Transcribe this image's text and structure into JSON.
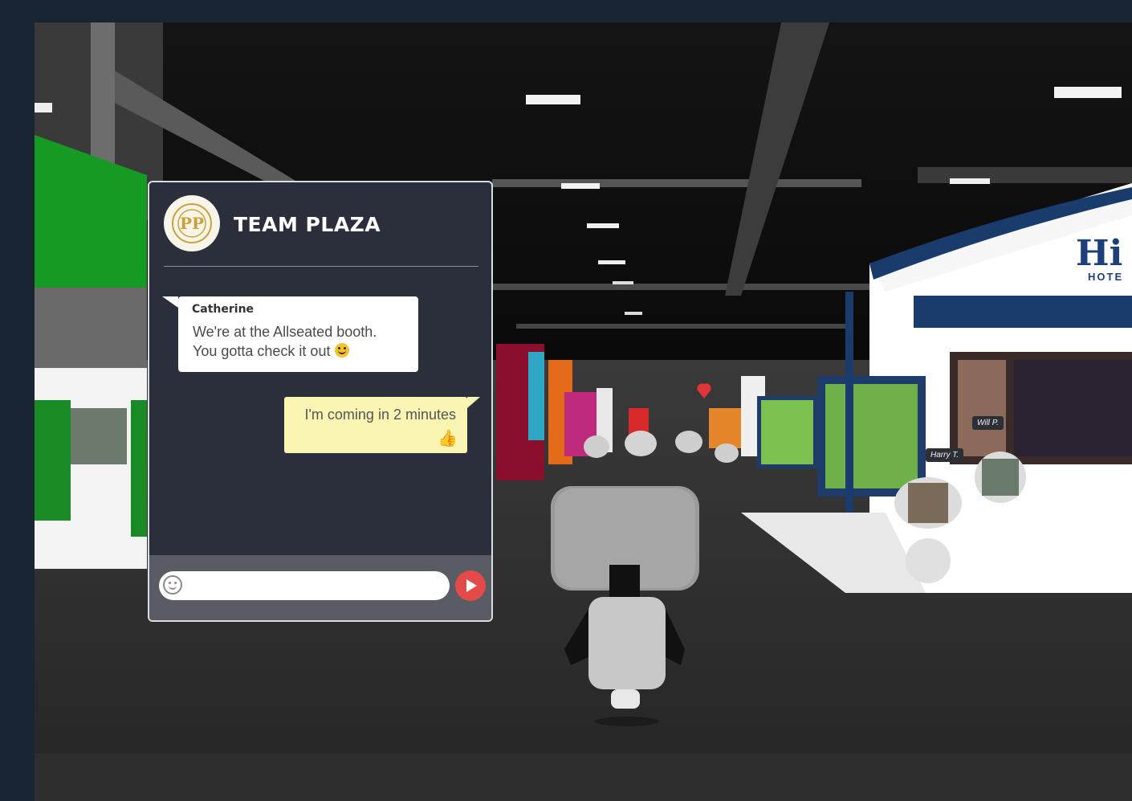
{
  "chat": {
    "team_name": "TEAM PLAZA",
    "logo": "team-plaza-crest",
    "messages": [
      {
        "sender": "Catherine",
        "text_line1": "We're at the Allseated booth.",
        "text_line2": "You gotta check it out",
        "emoji": "smiley-emoji"
      },
      {
        "sender": "",
        "text_line1": "I'm coming in 2 minutes",
        "emoji": "thumbs-up-emoji"
      }
    ],
    "input": {
      "placeholder": "",
      "value": ""
    },
    "send_icon": "send-arrow-icon"
  },
  "scene": {
    "booth_sign": "Hi",
    "booth_sign_sub": "HOTE",
    "avatar_tags": [
      "Will P.",
      "Harry T."
    ]
  },
  "colors": {
    "panel_bg": "#2b2f3b",
    "incoming_bubble": "#ffffff",
    "outgoing_bubble": "#fbf5b4",
    "send_button": "#e44a4a",
    "page_bg": "#1a2533"
  }
}
